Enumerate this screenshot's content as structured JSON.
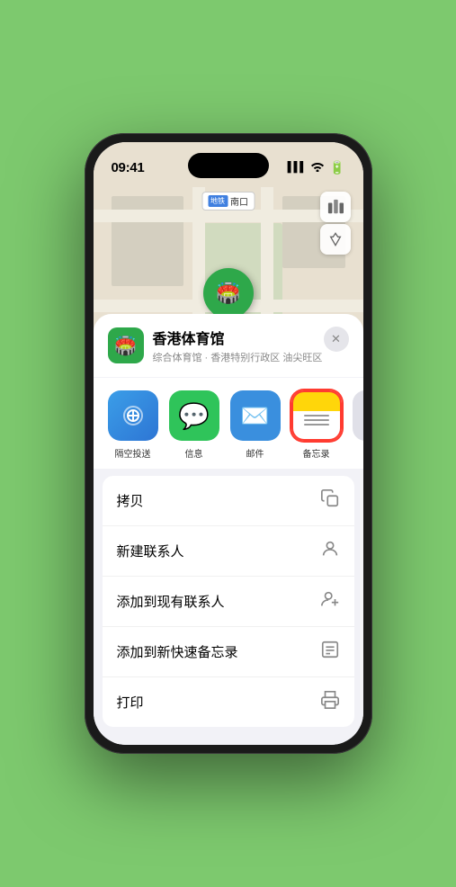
{
  "status_bar": {
    "time": "09:41",
    "signal": "▌▌▌",
    "wifi": "WiFi",
    "battery": "🔋"
  },
  "map": {
    "location_label_prefix": "南口",
    "venue_name": "香港体育馆",
    "pin_emoji": "🏟️"
  },
  "venue_card": {
    "title": "香港体育馆",
    "subtitle": "综合体育馆 · 香港特别行政区 油尖旺区",
    "close": "✕"
  },
  "share_items": [
    {
      "label": "隔空投送",
      "type": "airdrop"
    },
    {
      "label": "信息",
      "type": "messages"
    },
    {
      "label": "邮件",
      "type": "mail"
    },
    {
      "label": "备忘录",
      "type": "notes",
      "selected": true
    }
  ],
  "actions": [
    {
      "label": "拷贝",
      "icon": "copy"
    },
    {
      "label": "新建联系人",
      "icon": "person"
    },
    {
      "label": "添加到现有联系人",
      "icon": "person-add"
    },
    {
      "label": "添加到新快速备忘录",
      "icon": "note"
    },
    {
      "label": "打印",
      "icon": "print"
    }
  ]
}
